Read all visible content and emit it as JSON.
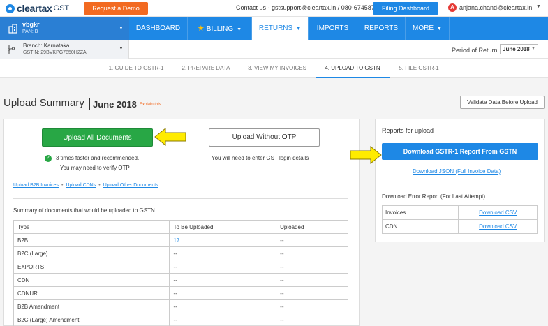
{
  "topbar": {
    "logo_text": "cleartax",
    "logo_sub": "GST",
    "demo_label": "Request a Demo",
    "contact": "Contact us - gstsupport@cleartax.in / 080-67458707",
    "filing_label": "Filing Dashboard",
    "avatar_initial": "A",
    "user_email": "anjana.chand@cleartax.in"
  },
  "org": {
    "name": "vbgkr",
    "pan": "PAN: B"
  },
  "nav": {
    "items": [
      {
        "label": "DASHBOARD"
      },
      {
        "label": "BILLING"
      },
      {
        "label": "RETURNS"
      },
      {
        "label": "IMPORTS"
      },
      {
        "label": "REPORTS"
      },
      {
        "label": "MORE"
      }
    ]
  },
  "branch": {
    "name": "Branch: Karnataka",
    "gstin": "GSTIN: 29BVKPG7850H2ZA",
    "period_label": "Period of Return",
    "period_value": "June 2018"
  },
  "steps": [
    {
      "label": "1. GUIDE TO GSTR-1"
    },
    {
      "label": "2. PREPARE DATA"
    },
    {
      "label": "3. VIEW MY INVOICES"
    },
    {
      "label": "4. UPLOAD TO GSTN"
    },
    {
      "label": "5. FILE GSTR-1"
    }
  ],
  "heading": {
    "title": "Upload Summary",
    "period": "June 2018",
    "explain": "Explain this",
    "validate_label": "Validate Data Before Upload"
  },
  "upload": {
    "all_label": "Upload All Documents",
    "otp_label": "Upload Without OTP",
    "hint_faster": "3 times faster and recommended.",
    "hint_verify": "You may need to verify OTP",
    "hint_login": "You will need to enter GST login details",
    "link_b2b": "Upload B2B Invoices",
    "link_cdn": "Upload CDNs",
    "link_other": "Upload Other Documents",
    "link_sep": "•"
  },
  "summary": {
    "caption": "Summary of documents that would be uploaded to GSTN",
    "headers": [
      "Type",
      "To Be Uploaded",
      "Uploaded"
    ],
    "rows": [
      [
        "B2B",
        "17",
        "--"
      ],
      [
        "B2C (Large)",
        "--",
        "--"
      ],
      [
        "EXPORTS",
        "--",
        "--"
      ],
      [
        "CDN",
        "--",
        "--"
      ],
      [
        "CDNUR",
        "--",
        "--"
      ],
      [
        "B2B Amendment",
        "--",
        "--"
      ],
      [
        "B2C (Large) Amendment",
        "--",
        "--"
      ]
    ]
  },
  "reports": {
    "title": "Reports for upload",
    "download_gstr1": "Download GSTR-1 Report From GSTN",
    "download_json": "Download JSON (Full Invoice Data)",
    "error_title": "Download Error Report (For Last Attempt)",
    "error_rows": [
      [
        "Invoices",
        "Download CSV"
      ],
      [
        "CDN",
        "Download CSV"
      ]
    ]
  },
  "colors": {
    "brand_blue": "#1e88e5",
    "demo_orange": "#f26a21",
    "upload_green": "#28a745",
    "arrow_yellow": "#ffeb00"
  }
}
